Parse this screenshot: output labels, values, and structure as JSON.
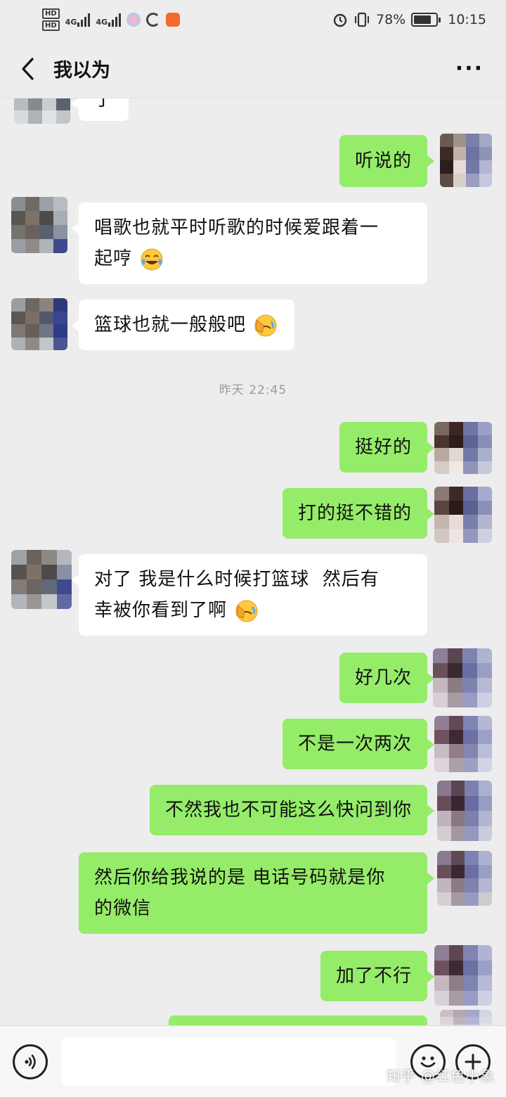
{
  "status_bar": {
    "hd1": "HD",
    "hd2": "HD",
    "sim1_net": "4G",
    "sim2_net": "4G",
    "battery": "78%",
    "time": "10:15"
  },
  "nav": {
    "title": "我以为"
  },
  "messages": [
    {
      "side": "recv",
      "text": "了"
    },
    {
      "side": "sent",
      "text": "听说的"
    },
    {
      "side": "recv",
      "line1": "唱歌也就平时听歌的时候爱跟着一",
      "line2": "起哼"
    },
    {
      "side": "recv",
      "text": "篮球也就一般般吧"
    },
    {
      "side": "sent",
      "text": "挺好的"
    },
    {
      "side": "sent",
      "text": "打的挺不错的"
    },
    {
      "side": "recv",
      "line1": "对了 我是什么时候打篮球  然后有",
      "line2": "幸被你看到了啊"
    },
    {
      "side": "sent",
      "text": "好几次"
    },
    {
      "side": "sent",
      "text": "不是一次两次"
    },
    {
      "side": "sent",
      "text": "不然我也不可能这么快问到你"
    },
    {
      "side": "sent",
      "line1": "然后你给我说的是 电话号码就是你",
      "line2": "的微信"
    },
    {
      "side": "sent",
      "text": "加了不行"
    }
  ],
  "timestamp": "昨天 22:45",
  "input": {
    "value": ""
  },
  "watermark": "知乎 @红色小象",
  "colors": {
    "sent_bubble": "#95ec69",
    "recv_bubble": "#ffffff",
    "background": "#ededed"
  }
}
